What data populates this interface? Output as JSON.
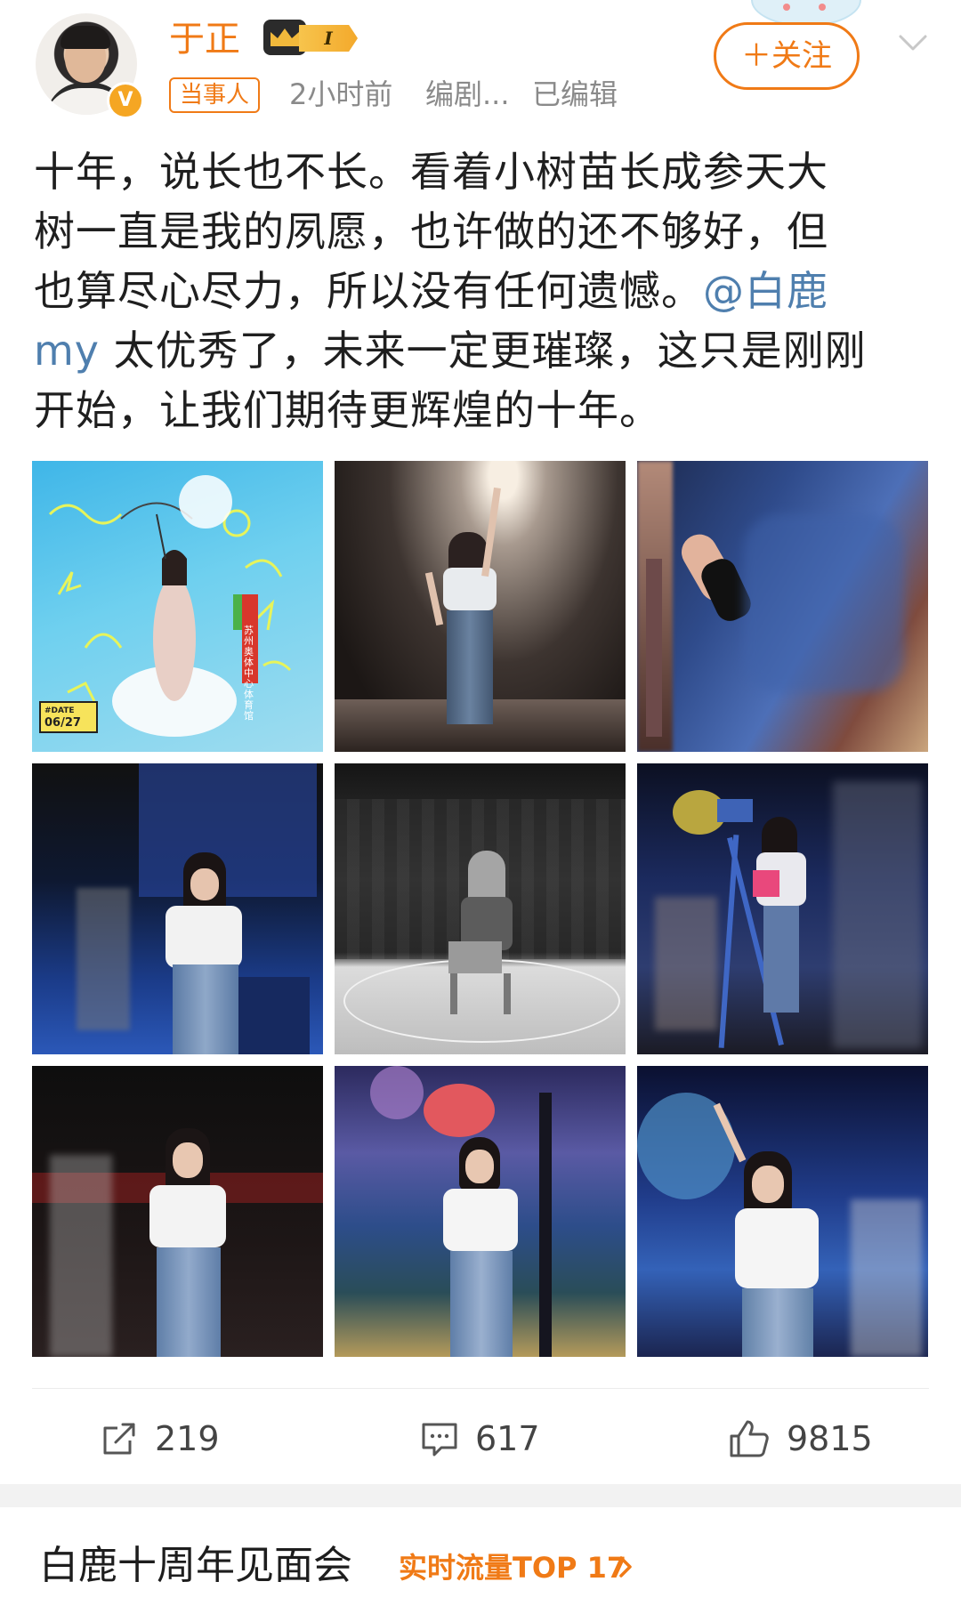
{
  "post": {
    "author": {
      "name": "于正",
      "member_level": "I",
      "verified_badge": "V"
    },
    "tag": "当事人",
    "time": "2小时前",
    "source": "编剧...",
    "edited": "已编辑",
    "follow_label": "＋关注",
    "text_lines": [
      "十年，说长也不长。看着小树苗长成参天大",
      "树一直是我的夙愿，也许做的还不够好，但",
      "也算尽心尽力，所以没有任何遗憾。"
    ],
    "mention_part1": "@白鹿",
    "mention_part2": "my",
    "text_line4_rest": " 太优秀了，未来一定更璀璨，这只是刚刚",
    "text_line5": "开始，让我们期待更辉煌的十年。",
    "images": [
      {
        "alt": "concert-poster",
        "poster_date": "06/27",
        "poster_text": "苏州奥体中心体育馆"
      },
      {
        "alt": "stage-spotlight-photo"
      },
      {
        "alt": "microphone-closeup-photo"
      },
      {
        "alt": "rehearsal-photo-1"
      },
      {
        "alt": "chair-on-stage-photo"
      },
      {
        "alt": "rehearsal-with-camera-photo"
      },
      {
        "alt": "rehearsal-photo-2"
      },
      {
        "alt": "singing-stage-photo"
      },
      {
        "alt": "pose-stage-photo"
      }
    ]
  },
  "actions": {
    "repost_count": "219",
    "comment_count": "617",
    "like_count": "9815"
  },
  "topic": {
    "title": "白鹿十周年见面会",
    "rank": "实时流量TOP 17"
  },
  "colors": {
    "accent": "#f07a16",
    "mention": "#4f7fae",
    "meta": "#8a8a8a"
  },
  "icons": {
    "repost": "repost-icon",
    "comment": "comment-icon",
    "like": "like-icon",
    "more": "chevron-down-icon",
    "topic_arrow": "chevron-right-icon"
  }
}
